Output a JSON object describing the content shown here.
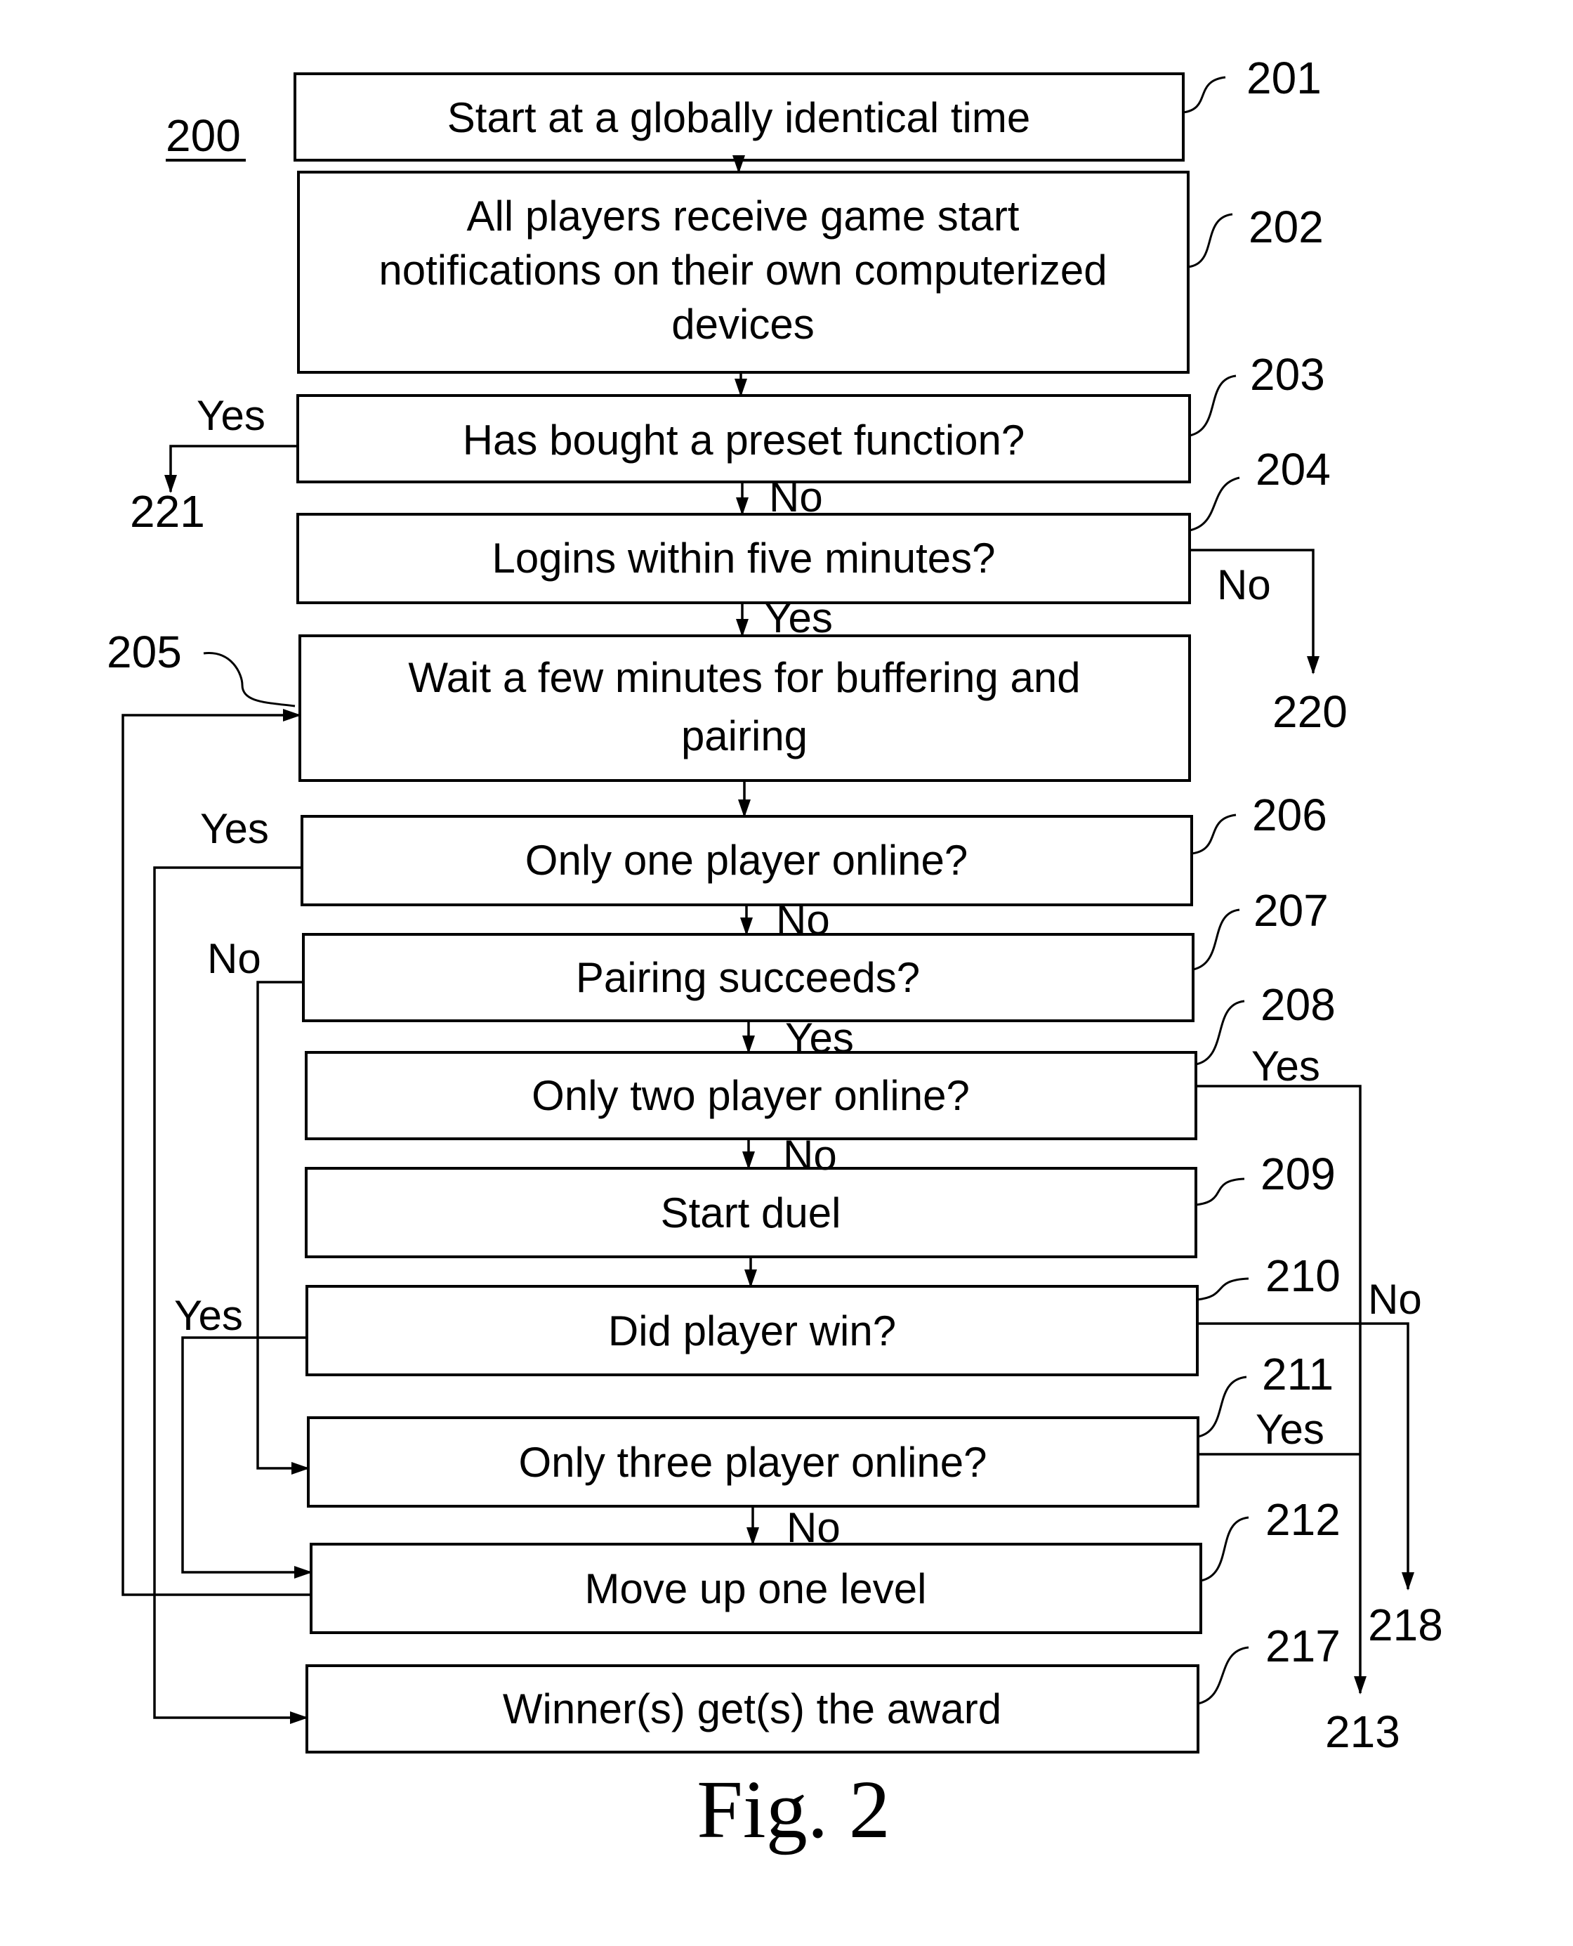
{
  "figure": {
    "id_label": "200",
    "caption": "Fig. 2"
  },
  "steps": [
    {
      "ref": "201",
      "lines": [
        "Start at a globally identical time"
      ]
    },
    {
      "ref": "202",
      "lines": [
        "All players receive game start",
        "notifications on their own computerized",
        "devices"
      ]
    },
    {
      "ref": "203",
      "lines": [
        "Has bought a preset function?"
      ]
    },
    {
      "ref": "204",
      "lines": [
        "Logins within five minutes?"
      ]
    },
    {
      "ref": "205",
      "lines": [
        "Wait a few minutes for buffering and",
        "pairing"
      ]
    },
    {
      "ref": "206",
      "lines": [
        "Only one player online?"
      ]
    },
    {
      "ref": "207",
      "lines": [
        "Pairing succeeds?"
      ]
    },
    {
      "ref": "208",
      "lines": [
        "Only two player online?"
      ]
    },
    {
      "ref": "209",
      "lines": [
        "Start duel"
      ]
    },
    {
      "ref": "210",
      "lines": [
        "Did player win?"
      ]
    },
    {
      "ref": "211",
      "lines": [
        "Only three player online?"
      ]
    },
    {
      "ref": "212",
      "lines": [
        "Move up one level"
      ]
    },
    {
      "ref": "217",
      "lines": [
        "Winner(s) get(s) the award"
      ]
    }
  ],
  "branch_labels": {
    "b203_yes": "Yes",
    "b203_no": "No",
    "b204_yes": "Yes",
    "b204_no": "No",
    "b206_yes": "Yes",
    "b206_no": "No",
    "b207_no": "No",
    "b207_yes": "Yes",
    "b208_yes": "Yes",
    "b208_no": "No",
    "b210_yes": "Yes",
    "b210_no": "No",
    "b211_yes": "Yes",
    "b211_no": "No"
  },
  "offpage_refs": {
    "r221": "221",
    "r220": "220",
    "r218": "218",
    "r213": "213"
  }
}
